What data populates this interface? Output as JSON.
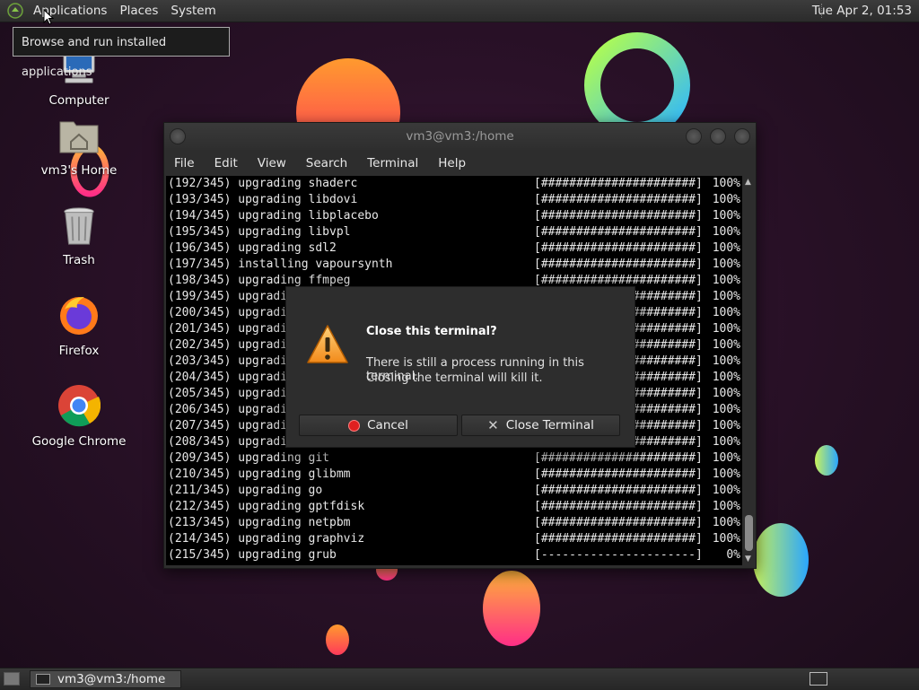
{
  "top_panel": {
    "menus": [
      "Applications",
      "Places",
      "System"
    ],
    "clock": "Tue Apr  2, 01:53",
    "logo_icon": "mate-logo-icon"
  },
  "tooltip": "Browse and run installed applications",
  "desktop_icons": [
    {
      "label": "Computer",
      "icon": "computer-icon"
    },
    {
      "label": "vm3's Home",
      "icon": "home-folder-icon"
    },
    {
      "label": "Trash",
      "icon": "trash-icon"
    },
    {
      "label": "Firefox",
      "icon": "firefox-icon"
    },
    {
      "label": "Google Chrome",
      "icon": "chrome-icon"
    }
  ],
  "terminal": {
    "title": "vm3@vm3:/home",
    "menus": [
      "File",
      "Edit",
      "View",
      "Search",
      "Terminal",
      "Help"
    ],
    "lines": [
      {
        "text": "(192/345) upgrading shaderc",
        "bar": "[######################]",
        "pct": "100%"
      },
      {
        "text": "(193/345) upgrading libdovi",
        "bar": "[######################]",
        "pct": "100%"
      },
      {
        "text": "(194/345) upgrading libplacebo",
        "bar": "[######################]",
        "pct": "100%"
      },
      {
        "text": "(195/345) upgrading libvpl",
        "bar": "[######################]",
        "pct": "100%"
      },
      {
        "text": "(196/345) upgrading sdl2",
        "bar": "[######################]",
        "pct": "100%"
      },
      {
        "text": "(197/345) installing vapoursynth",
        "bar": "[######################]",
        "pct": "100%"
      },
      {
        "text": "(198/345) upgrading ffmpeg",
        "bar": "[######################]",
        "pct": "100%"
      },
      {
        "text": "(199/345) upgradi",
        "bar": "[######################]",
        "pct": "100%"
      },
      {
        "text": "(200/345) upgradi",
        "bar": "[######################]",
        "pct": "100%"
      },
      {
        "text": "(201/345) upgradi",
        "bar": "[######################]",
        "pct": "100%"
      },
      {
        "text": "(202/345) upgradi",
        "bar": "[######################]",
        "pct": "100%"
      },
      {
        "text": "(203/345) upgradi",
        "bar": "[######################]",
        "pct": "100%"
      },
      {
        "text": "(204/345) upgradi",
        "bar": "[######################]",
        "pct": "100%"
      },
      {
        "text": "(205/345) upgradi",
        "bar": "[######################]",
        "pct": "100%"
      },
      {
        "text": "(206/345) upgradi",
        "bar": "[######################]",
        "pct": "100%"
      },
      {
        "text": "(207/345) upgradi",
        "bar": "[######################]",
        "pct": "100%"
      },
      {
        "text": "(208/345) upgradi",
        "bar": "[######################]",
        "pct": "100%"
      },
      {
        "text": "(209/345) upgrading git",
        "bar": "[######################]",
        "pct": "100%"
      },
      {
        "text": "(210/345) upgrading glibmm",
        "bar": "[######################]",
        "pct": "100%"
      },
      {
        "text": "(211/345) upgrading go",
        "bar": "[######################]",
        "pct": "100%"
      },
      {
        "text": "(212/345) upgrading gptfdisk",
        "bar": "[######################]",
        "pct": "100%"
      },
      {
        "text": "(213/345) upgrading netpbm",
        "bar": "[######################]",
        "pct": "100%"
      },
      {
        "text": "(214/345) upgrading graphviz",
        "bar": "[######################]",
        "pct": "100%"
      },
      {
        "text": "(215/345) upgrading grub",
        "bar": "[----------------------]",
        "pct": "0%"
      }
    ]
  },
  "dialog": {
    "title": "Close this terminal?",
    "message_line1": "There is still a process running in this terminal.",
    "message_line2": "Closing the terminal will kill it.",
    "cancel_label": "Cancel",
    "close_label": "Close Terminal",
    "icon": "warning-icon"
  },
  "bottom_panel": {
    "taskbar_item": "vm3@vm3:/home"
  },
  "colors": {
    "desktop_bg": "#2a1128",
    "terminal_bg": "#000000",
    "cancel_red": "#e02020"
  }
}
